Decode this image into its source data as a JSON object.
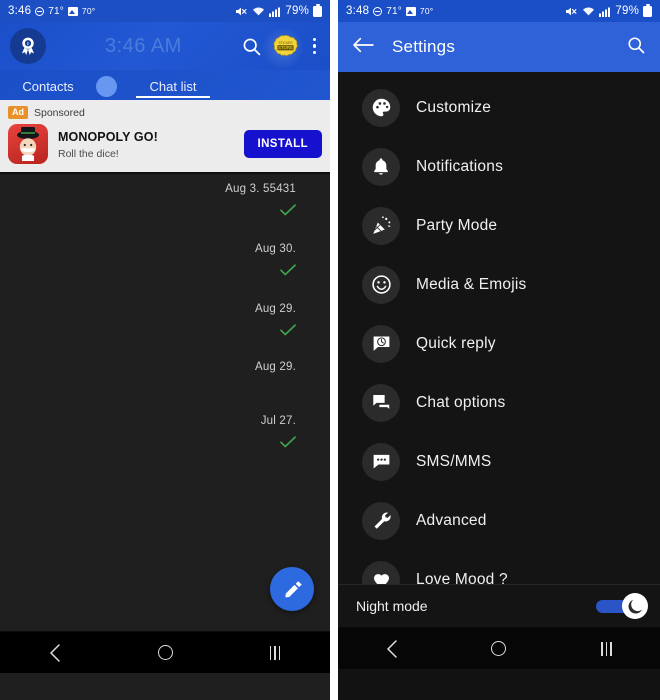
{
  "left_phone": {
    "status_bar": {
      "time": "3:46",
      "dnd_icon": "do-not-disturb-icon",
      "temp_primary": "71°",
      "weather_icon": "weather-photo-icon",
      "temp_secondary": "70°",
      "mute_icon": "volume-mute-icon",
      "wifi_icon": "wifi-icon",
      "signal_icon": "cell-signal-icon",
      "battery_text": "79%",
      "battery_icon": "battery-icon"
    },
    "app_bar": {
      "avatar_icon": "profile-badge-avatar",
      "ghost_time": "3:46 AM",
      "search_icon": "search-icon",
      "store_icon": "sticker-store-icon",
      "store_label": "STORE",
      "overflow_icon": "overflow-menu-icon"
    },
    "tabs": [
      {
        "label": "Contacts",
        "active": false
      },
      {
        "label": "Chat list",
        "active": true
      }
    ],
    "ad": {
      "badge": "Ad",
      "sponsored": "Sponsored",
      "title": "MONOPOLY GO!",
      "subtitle": "Roll the dice!",
      "install_label": "INSTALL",
      "app_icon": "monopoly-man-icon",
      "install_color": "#1610cf",
      "badge_color": "#e8912a"
    },
    "chat_rows": [
      {
        "date": "Aug 3. 55431",
        "has_check": true
      },
      {
        "date": "Aug 30.",
        "has_check": true
      },
      {
        "date": "Aug 29.",
        "has_check": true
      },
      {
        "date": "Aug 29.",
        "has_check": false
      },
      {
        "date": "Jul 27.",
        "has_check": true
      }
    ],
    "check_color": "#3fa34d",
    "fab": {
      "icon": "compose-pencil-icon",
      "color": "#2d6ae0"
    }
  },
  "right_phone": {
    "status_bar": {
      "time": "3:48",
      "dnd_icon": "do-not-disturb-icon",
      "temp_primary": "71°",
      "weather_icon": "weather-photo-icon",
      "temp_secondary": "70°",
      "mute_icon": "volume-mute-icon",
      "wifi_icon": "wifi-icon",
      "signal_icon": "cell-signal-icon",
      "battery_text": "79%",
      "battery_icon": "battery-icon"
    },
    "app_bar": {
      "back_icon": "back-arrow-icon",
      "title": "Settings",
      "search_icon": "search-icon",
      "bar_color": "#2f62d8"
    },
    "settings_items": [
      {
        "label": "Customize",
        "icon": "palette-icon"
      },
      {
        "label": "Notifications",
        "icon": "bell-icon"
      },
      {
        "label": "Party Mode",
        "icon": "party-popper-icon"
      },
      {
        "label": "Media & Emojis",
        "icon": "smiley-face-icon"
      },
      {
        "label": "Quick reply",
        "icon": "chat-bubble-clock-icon"
      },
      {
        "label": "Chat options",
        "icon": "double-chat-bubble-icon"
      },
      {
        "label": "SMS/MMS",
        "icon": "chat-bubble-dots-icon"
      },
      {
        "label": "Advanced",
        "icon": "wrench-icon"
      },
      {
        "label": "Love Mood ?",
        "icon": "heart-icon"
      }
    ],
    "night_mode": {
      "label": "Night mode",
      "enabled": true,
      "thumb_icon": "crescent-moon-face-icon",
      "track_color": "#2b55c7"
    }
  },
  "nav_bar": {
    "back_icon": "nav-back-icon",
    "home_icon": "nav-home-icon",
    "recents_icon": "nav-recents-icon"
  }
}
